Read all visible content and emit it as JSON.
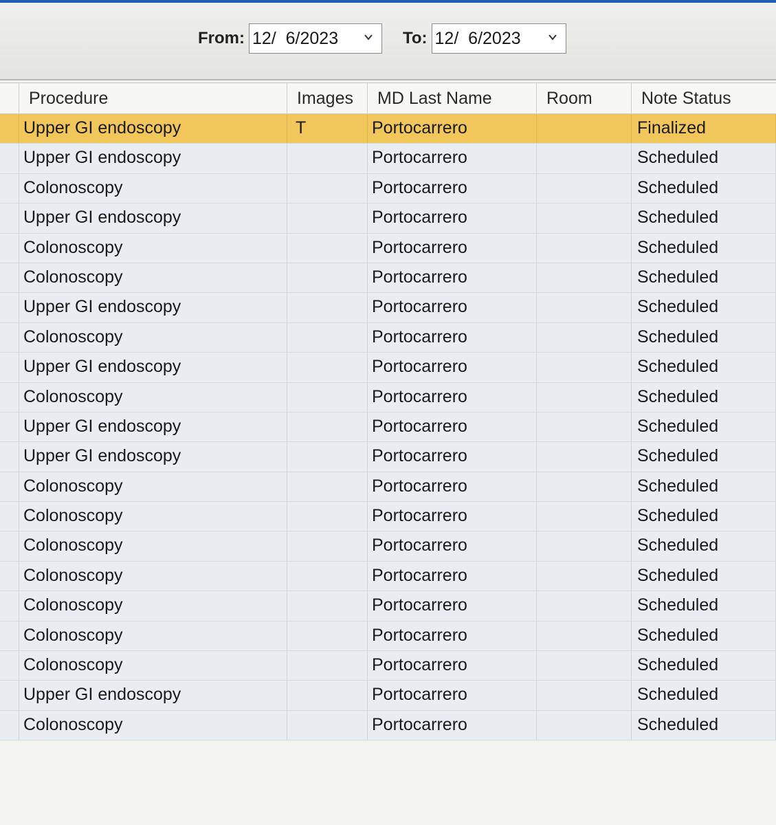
{
  "filter": {
    "from_label": "From:",
    "from_value": "12/  6/2023",
    "to_label": "To:",
    "to_value": "12/  6/2023"
  },
  "columns": {
    "procedure": "Procedure",
    "images": "Images",
    "md_last_name": "MD Last Name",
    "room": "Room",
    "note_status": "Note Status"
  },
  "rows": [
    {
      "procedure": "Upper GI endoscopy",
      "images": "T",
      "md": "Portocarrero",
      "room": "",
      "status": "Finalized",
      "selected": true
    },
    {
      "procedure": "Upper GI endoscopy",
      "images": "",
      "md": "Portocarrero",
      "room": "",
      "status": "Scheduled"
    },
    {
      "procedure": "Colonoscopy",
      "images": "",
      "md": "Portocarrero",
      "room": "",
      "status": "Scheduled"
    },
    {
      "procedure": "Upper GI endoscopy",
      "images": "",
      "md": "Portocarrero",
      "room": "",
      "status": "Scheduled"
    },
    {
      "procedure": "Colonoscopy",
      "images": "",
      "md": "Portocarrero",
      "room": "",
      "status": "Scheduled"
    },
    {
      "procedure": "Colonoscopy",
      "images": "",
      "md": "Portocarrero",
      "room": "",
      "status": "Scheduled"
    },
    {
      "procedure": "Upper GI endoscopy",
      "images": "",
      "md": "Portocarrero",
      "room": "",
      "status": "Scheduled"
    },
    {
      "procedure": "Colonoscopy",
      "images": "",
      "md": "Portocarrero",
      "room": "",
      "status": "Scheduled"
    },
    {
      "procedure": "Upper GI endoscopy",
      "images": "",
      "md": "Portocarrero",
      "room": "",
      "status": "Scheduled"
    },
    {
      "procedure": "Colonoscopy",
      "images": "",
      "md": "Portocarrero",
      "room": "",
      "status": "Scheduled"
    },
    {
      "procedure": "Upper GI endoscopy",
      "images": "",
      "md": "Portocarrero",
      "room": "",
      "status": "Scheduled"
    },
    {
      "procedure": "Upper GI endoscopy",
      "images": "",
      "md": "Portocarrero",
      "room": "",
      "status": "Scheduled"
    },
    {
      "procedure": "Colonoscopy",
      "images": "",
      "md": "Portocarrero",
      "room": "",
      "status": "Scheduled"
    },
    {
      "procedure": "Colonoscopy",
      "images": "",
      "md": "Portocarrero",
      "room": "",
      "status": "Scheduled"
    },
    {
      "procedure": "Colonoscopy",
      "images": "",
      "md": "Portocarrero",
      "room": "",
      "status": "Scheduled"
    },
    {
      "procedure": "Colonoscopy",
      "images": "",
      "md": "Portocarrero",
      "room": "",
      "status": "Scheduled"
    },
    {
      "procedure": "Colonoscopy",
      "images": "",
      "md": "Portocarrero",
      "room": "",
      "status": "Scheduled"
    },
    {
      "procedure": "Colonoscopy",
      "images": "",
      "md": "Portocarrero",
      "room": "",
      "status": "Scheduled"
    },
    {
      "procedure": "Colonoscopy",
      "images": "",
      "md": "Portocarrero",
      "room": "",
      "status": "Scheduled"
    },
    {
      "procedure": "Upper GI endoscopy",
      "images": "",
      "md": "Portocarrero",
      "room": "",
      "status": "Scheduled"
    },
    {
      "procedure": "Colonoscopy",
      "images": "",
      "md": "Portocarrero",
      "room": "",
      "status": "Scheduled"
    }
  ],
  "colors": {
    "selected_row": "#f1c65b",
    "row_background": "#e9edf2",
    "accent": "#1f5fb0"
  },
  "icons": {
    "dropdown": "chevron-down-icon"
  }
}
